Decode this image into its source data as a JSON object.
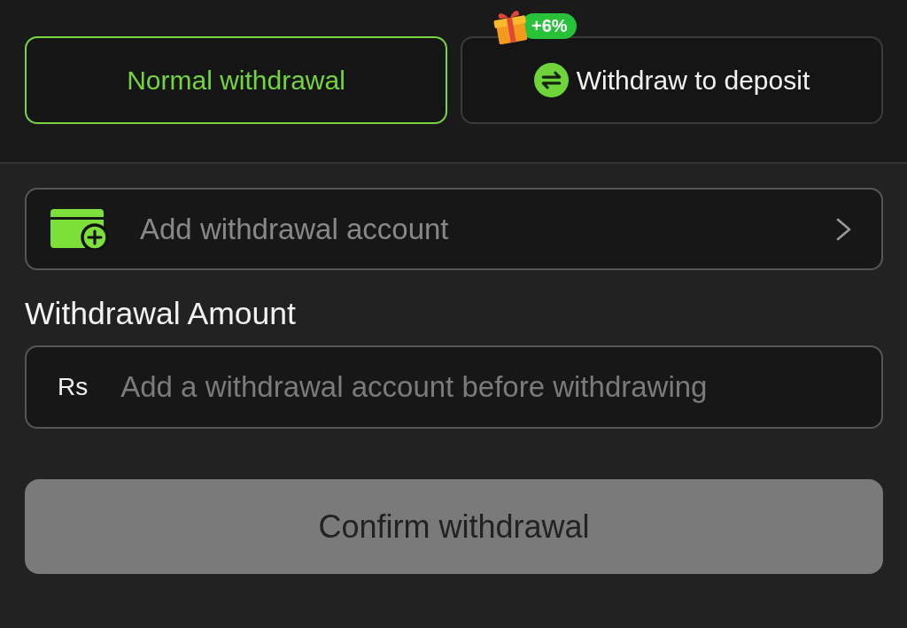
{
  "tabs": [
    {
      "label": "Normal withdrawal",
      "selected": true,
      "kind": "plain"
    },
    {
      "label": "Withdraw to deposit",
      "selected": false,
      "kind": "transfer",
      "badge": "+6%"
    }
  ],
  "account_selector": {
    "label": "Add withdrawal account"
  },
  "amount": {
    "label": "Withdrawal Amount",
    "currency": "Rs",
    "placeholder": "Add a withdrawal account before withdrawing"
  },
  "confirm_button": {
    "label": "Confirm withdrawal",
    "disabled": true
  }
}
